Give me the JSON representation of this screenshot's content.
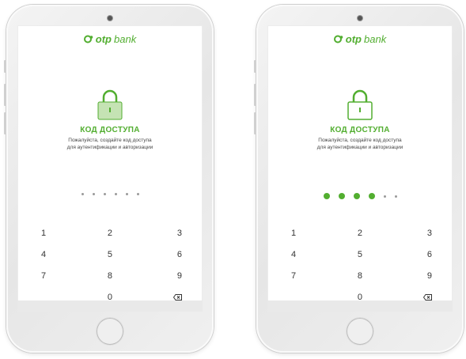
{
  "brand": {
    "bold": "otp",
    "light": "bank",
    "color": "#52ae30"
  },
  "screens": [
    {
      "title": "КОД ДОСТУПА",
      "subtitle_line1": "Пожалуйста, создайте код доступа",
      "subtitle_line2": "для аутентификации и авторизации",
      "pin_length": 6,
      "pin_filled": 0
    },
    {
      "title": "КОД ДОСТУПА",
      "subtitle_line1": "Пожалуйста, создайте код доступа",
      "subtitle_line2": "для аутентификации и авторизации",
      "pin_length": 6,
      "pin_filled": 4
    }
  ],
  "keypad": {
    "k1": "1",
    "k2": "2",
    "k3": "3",
    "k4": "4",
    "k5": "5",
    "k6": "6",
    "k7": "7",
    "k8": "8",
    "k9": "9",
    "k0": "0"
  },
  "icons": {
    "logo": "otp-logo-icon",
    "lock": "lock-icon",
    "backspace": "backspace-icon"
  }
}
